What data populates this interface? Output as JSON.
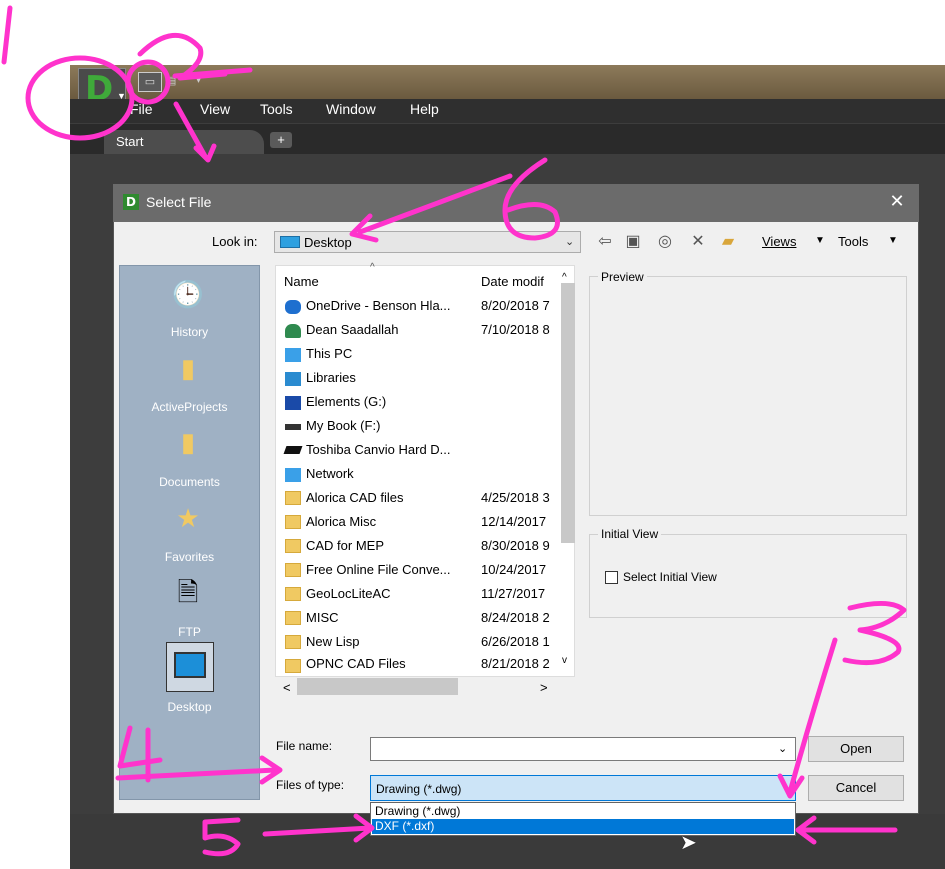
{
  "app": {
    "logo_letter": "D",
    "menu": [
      "File",
      "View",
      "Tools",
      "Window",
      "Help"
    ],
    "tabs": {
      "start": "Start",
      "add": "+"
    }
  },
  "dialog": {
    "title": "Select File",
    "close": "✕",
    "look_in_label": "Look in:",
    "look_in_value": "Desktop",
    "toolbar": {
      "views": "Views",
      "tools": "Tools"
    },
    "places": [
      {
        "label": "History",
        "icon": "history-icon"
      },
      {
        "label": "ActiveProjects",
        "icon": "folder-icon"
      },
      {
        "label": "Documents",
        "icon": "documents-icon"
      },
      {
        "label": "Favorites",
        "icon": "favorites-icon"
      },
      {
        "label": "FTP",
        "icon": "ftp-icon"
      },
      {
        "label": "Desktop",
        "icon": "desktop-icon"
      }
    ],
    "columns": {
      "name": "Name",
      "date": "Date modif"
    },
    "files": [
      {
        "name": "OneDrive - Benson Hla...",
        "date": "8/20/2018 7",
        "icon": "onedrive-icon"
      },
      {
        "name": "Dean Saadallah",
        "date": "7/10/2018 8",
        "icon": "user-icon"
      },
      {
        "name": "This PC",
        "date": "",
        "icon": "pc-icon"
      },
      {
        "name": "Libraries",
        "date": "",
        "icon": "libraries-icon"
      },
      {
        "name": "Elements (G:)",
        "date": "",
        "icon": "wd-drive-icon"
      },
      {
        "name": "My Book (F:)",
        "date": "",
        "icon": "drive-icon"
      },
      {
        "name": "Toshiba Canvio Hard D...",
        "date": "",
        "icon": "drive-icon"
      },
      {
        "name": "Network",
        "date": "",
        "icon": "network-icon"
      },
      {
        "name": "Alorica CAD files",
        "date": "4/25/2018 3",
        "icon": "folder-icon"
      },
      {
        "name": "Alorica Misc",
        "date": "12/14/2017",
        "icon": "folder-icon"
      },
      {
        "name": "CAD for MEP",
        "date": "8/30/2018 9",
        "icon": "folder-icon"
      },
      {
        "name": "Free Online File Conve...",
        "date": "10/24/2017",
        "icon": "folder-icon"
      },
      {
        "name": "GeoLocLiteAC",
        "date": "11/27/2017",
        "icon": "folder-icon"
      },
      {
        "name": "MISC",
        "date": "8/24/2018 2",
        "icon": "folder-icon"
      },
      {
        "name": "New Lisp",
        "date": "6/26/2018 1",
        "icon": "folder-icon"
      },
      {
        "name": "OPNC CAD Files",
        "date": "8/21/2018 2",
        "icon": "folder-icon"
      }
    ],
    "preview_label": "Preview",
    "initial_view_label": "Initial View",
    "select_initial_view": "Select Initial View",
    "file_name_label": "File name:",
    "file_name_value": "",
    "files_of_type_label": "Files of type:",
    "files_of_type_value": "Drawing (*.dwg)",
    "type_options": [
      "Drawing (*.dwg)",
      "DXF (*.dxf)"
    ],
    "open_button": "Open",
    "cancel_button": "Cancel"
  },
  "annotations": {
    "color": "#ff33cc",
    "numbers": [
      "1",
      "2",
      "3",
      "4",
      "5",
      "6"
    ]
  }
}
